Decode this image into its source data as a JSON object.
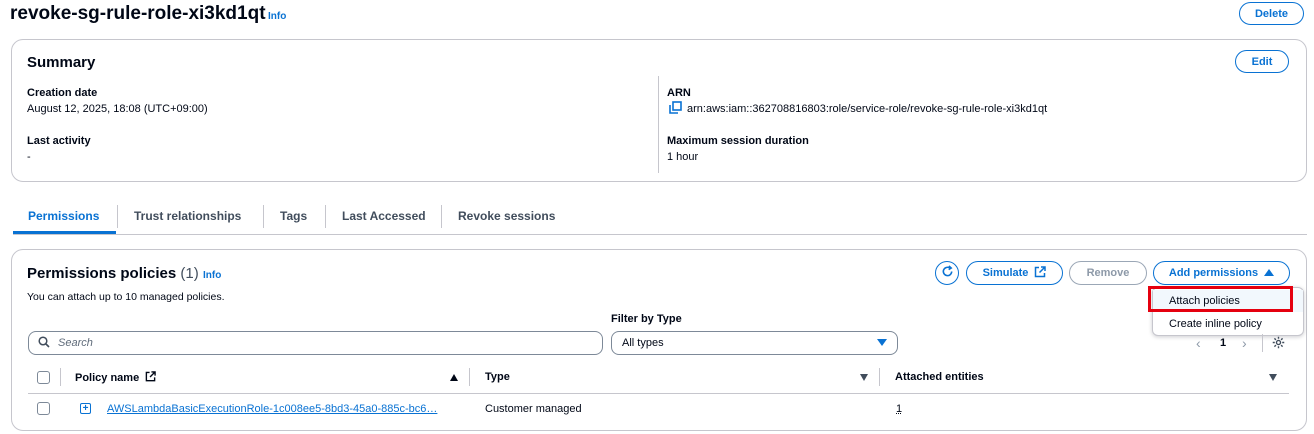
{
  "header": {
    "title": "revoke-sg-rule-role-xi3kd1qt",
    "info": "Info",
    "delete_label": "Delete"
  },
  "summary": {
    "title": "Summary",
    "edit_label": "Edit",
    "creation_date_label": "Creation date",
    "creation_date_value": "August 12, 2025, 18:08 (UTC+09:00)",
    "last_activity_label": "Last activity",
    "last_activity_value": "-",
    "arn_label": "ARN",
    "arn_value": "arn:aws:iam::362708816803:role/service-role/revoke-sg-rule-role-xi3kd1qt",
    "max_session_label": "Maximum session duration",
    "max_session_value": "1 hour"
  },
  "tabs": [
    {
      "label": "Permissions",
      "active": true
    },
    {
      "label": "Trust relationships"
    },
    {
      "label": "Tags"
    },
    {
      "label": "Last Accessed"
    },
    {
      "label": "Revoke sessions"
    }
  ],
  "permissions": {
    "title": "Permissions policies",
    "count": "(1)",
    "info": "Info",
    "subtitle": "You can attach up to 10 managed policies.",
    "simulate_label": "Simulate",
    "remove_label": "Remove",
    "add_permissions_label": "Add permissions",
    "dropdown": {
      "items": [
        "Attach policies",
        "Create inline policy"
      ]
    },
    "filter_label": "Filter by Type",
    "search_placeholder": "Search",
    "type_selected": "All types",
    "page": "1",
    "columns": [
      "Policy name",
      "Type",
      "Attached entities"
    ],
    "rows": [
      {
        "policy_name": "AWSLambdaBasicExecutionRole-1c008ee5-8bd3-45a0-885c-bc6…",
        "type": "Customer managed",
        "attached_entities": "1"
      }
    ]
  },
  "colors": {
    "accent": "#0972d3",
    "highlight": "#e5000f",
    "border": "#c6c6cd"
  }
}
